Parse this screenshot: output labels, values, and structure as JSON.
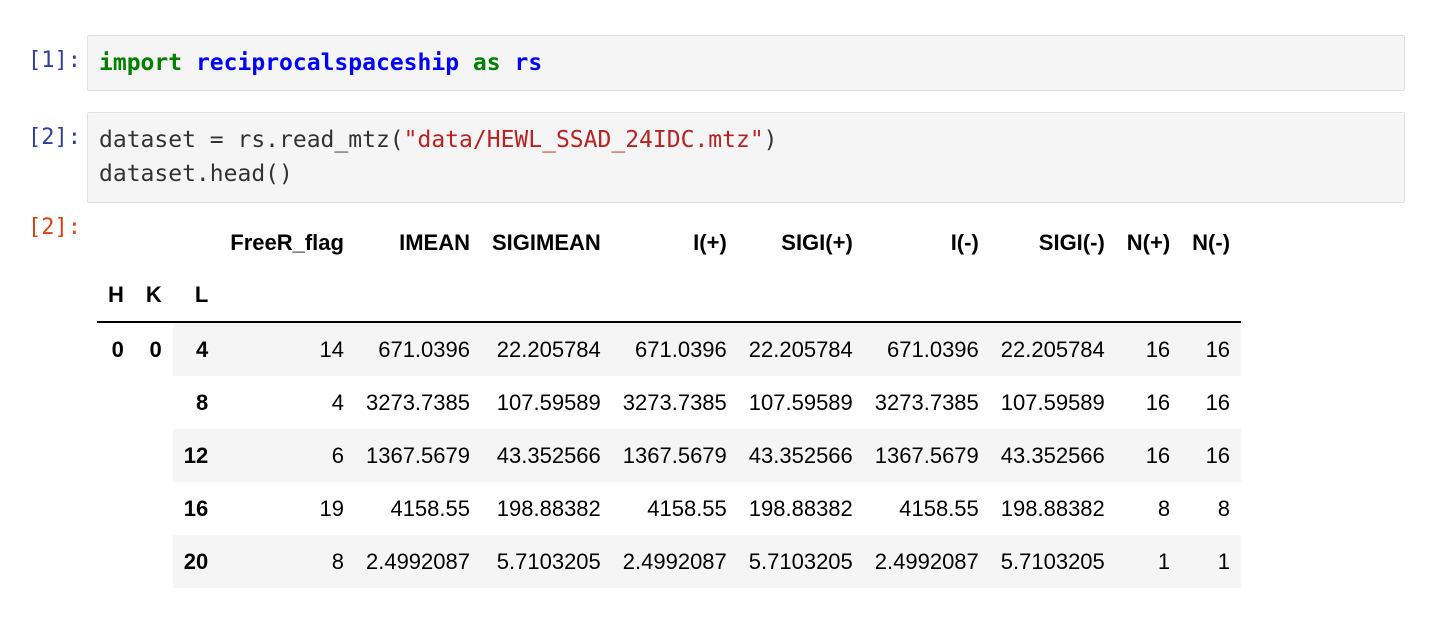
{
  "cells": [
    {
      "prompt": "[1]:",
      "code_tokens": [
        "import",
        " ",
        "reciprocalspaceship",
        " ",
        "as",
        " ",
        "rs"
      ]
    },
    {
      "prompt": "[2]:",
      "line1_prefix": "dataset = rs.read_mtz(",
      "line1_string": "\"data/HEWL_SSAD_24IDC.mtz\"",
      "line1_suffix": ")",
      "line2": "dataset.head()"
    }
  ],
  "output": {
    "prompt": "[2]:",
    "columns": [
      "FreeR_flag",
      "IMEAN",
      "SIGIMEAN",
      "I(+)",
      "SIGI(+)",
      "I(-)",
      "SIGI(-)",
      "N(+)",
      "N(-)"
    ],
    "index_names": [
      "H",
      "K",
      "L"
    ],
    "index_hk": [
      "0",
      "0"
    ],
    "rows": [
      {
        "L": "4",
        "values": [
          "14",
          "671.0396",
          "22.205784",
          "671.0396",
          "22.205784",
          "671.0396",
          "22.205784",
          "16",
          "16"
        ]
      },
      {
        "L": "8",
        "values": [
          "4",
          "3273.7385",
          "107.59589",
          "3273.7385",
          "107.59589",
          "3273.7385",
          "107.59589",
          "16",
          "16"
        ]
      },
      {
        "L": "12",
        "values": [
          "6",
          "1367.5679",
          "43.352566",
          "1367.5679",
          "43.352566",
          "1367.5679",
          "43.352566",
          "16",
          "16"
        ]
      },
      {
        "L": "16",
        "values": [
          "19",
          "4158.55",
          "198.88382",
          "4158.55",
          "198.88382",
          "4158.55",
          "198.88382",
          "8",
          "8"
        ]
      },
      {
        "L": "20",
        "values": [
          "8",
          "2.4992087",
          "5.7103205",
          "2.4992087",
          "5.7103205",
          "2.4992087",
          "5.7103205",
          "1",
          "1"
        ]
      }
    ]
  }
}
